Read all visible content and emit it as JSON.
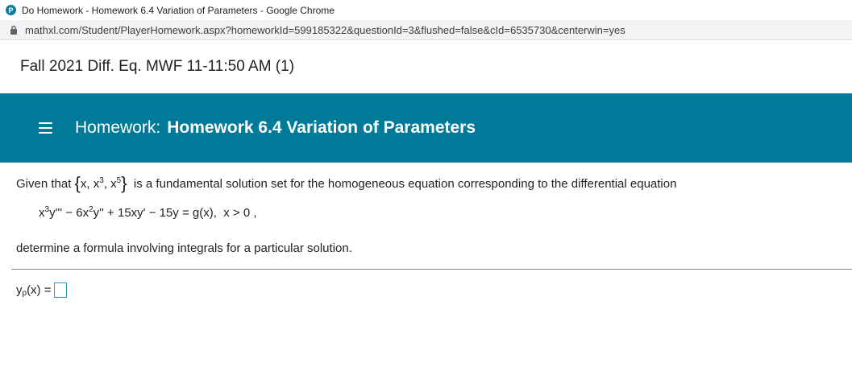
{
  "window": {
    "app_logo_letter": "P",
    "title": "Do Homework - Homework 6.4 Variation of Parameters - Google Chrome"
  },
  "address_bar": {
    "url": "mathxl.com/Student/PlayerHomework.aspx?homeworkId=599185322&questionId=3&flushed=false&cId=6535730&centerwin=yes"
  },
  "course": {
    "title": "Fall 2021 Diff. Eq. MWF 11-11:50 AM (1)"
  },
  "banner": {
    "prefix": "Homework:",
    "title": "Homework 6.4 Variation of Parameters"
  },
  "question": {
    "intro": "Given that",
    "set_open": "{",
    "set_x1": "x, x",
    "set_exp1": "3",
    "set_sep": ", x",
    "set_exp2": "5",
    "set_close": "}",
    "intro_rest": "is a fundamental solution set for the homogeneous equation corresponding to the differential equation",
    "eq_a": "x",
    "eq_a_exp": "3",
    "eq_b": "y''' − 6x",
    "eq_b_exp": "2",
    "eq_c": "y'' + 15xy' − 15y = g(x),  x > 0 ,",
    "instruction": "determine a formula involving integrals for a particular solution."
  },
  "answer": {
    "label_y": "y",
    "label_sub": "p",
    "label_rest": "(x) ="
  }
}
